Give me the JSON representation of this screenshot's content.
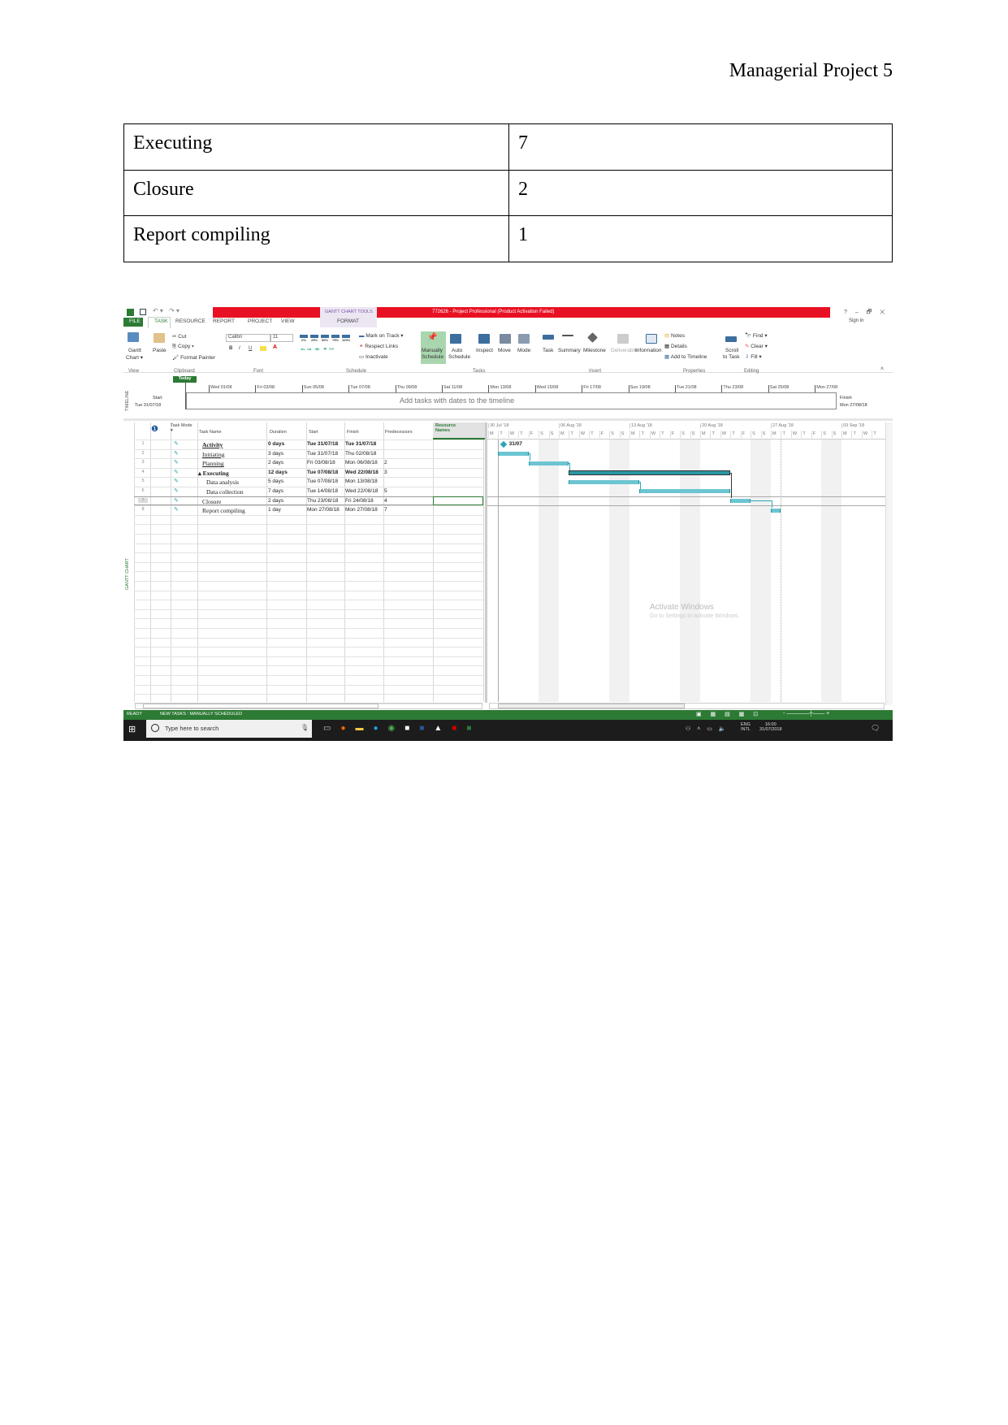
{
  "page_header": "Managerial Project 5",
  "phase_table": [
    [
      "Executing",
      "7"
    ],
    [
      "Closure",
      "2"
    ],
    [
      "Report compiling",
      "1"
    ]
  ],
  "app": {
    "title": "772626 - Project Professional (Product Activation Failed)",
    "context_tab": "GANTT CHART TOOLS",
    "window_controls": [
      "?",
      "–",
      "🗗",
      "✕"
    ],
    "sign_in": "Sign in",
    "tabs": [
      "FILE",
      "TASK",
      "RESOURCE",
      "REPORT",
      "PROJECT",
      "VIEW",
      "FORMAT"
    ],
    "active_tab": "TASK",
    "ribbon": {
      "view": {
        "gantt": "Gantt",
        "chart": "Chart ▾",
        "group": "View"
      },
      "clipboard": {
        "paste": "Paste",
        "cut": "Cut",
        "copy": "Copy ▾",
        "format_painter": "Format Painter",
        "group": "Clipboard"
      },
      "font": {
        "name": "Calibri",
        "size": "11",
        "bold": "B",
        "italic": "I",
        "underline": "U",
        "group": "Font"
      },
      "schedule": {
        "pcts": [
          "0%",
          "25%",
          "50%",
          "75%",
          "100%"
        ],
        "mark_on_track": "Mark on Track ▾",
        "respect_links": "Respect Links",
        "inactivate": "Inactivate",
        "group": "Schedule"
      },
      "tasks": {
        "manually": "Manually",
        "schedule1": "Schedule",
        "auto": "Auto",
        "schedule2": "Schedule",
        "inspect": "Inspect",
        "move": "Move",
        "mode": "Mode",
        "group": "Tasks"
      },
      "insert": {
        "task": "Task",
        "summary": "Summary",
        "milestone": "Milestone",
        "deliverable": "Deliverable",
        "group": "Insert"
      },
      "properties": {
        "information": "Information",
        "notes": "Notes",
        "details": "Details",
        "add_to_timeline": "Add to Timeline",
        "group": "Properties"
      },
      "editing": {
        "scroll": "Scroll",
        "to_task": "to Task",
        "find": "Find ▾",
        "clear": "Clear ▾",
        "fill": "Fill ▾",
        "group": "Editing"
      }
    },
    "timeline": {
      "side_label": "TIMELINE",
      "today": "Today",
      "start_label": "Start",
      "start_date": "Tue 31/07/18",
      "finish_label": "Finish",
      "finish_date": "Mon 27/08/18",
      "placeholder": "Add tasks with dates to the timeline",
      "ticks": [
        "Wed 01/08",
        "Fri 03/08",
        "Sun 05/08",
        "Tue 07/08",
        "Thu 09/08",
        "Sat 11/08",
        "Mon 13/08",
        "Wed 15/08",
        "Fri 17/08",
        "Sun 19/08",
        "Tue 21/08",
        "Thu 23/08",
        "Sat 25/08",
        "Mon 27/08"
      ]
    },
    "grid": {
      "side_label": "GANTT CHART",
      "columns": {
        "mode": "Task Mode ▾",
        "name": "Task Name",
        "duration": "Duration",
        "start": "Start",
        "finish": "Finish",
        "pred": "Predecessors",
        "res": "Resource Names"
      },
      "rows": [
        {
          "id": "1",
          "name": "Activity",
          "duration": "0 days",
          "start": "Tue 31/07/18",
          "finish": "Tue 31/07/18",
          "pred": "",
          "bold": true,
          "s": "2018-07-31",
          "f": "2018-07-31",
          "milestone": true
        },
        {
          "id": "2",
          "name": "Initiating",
          "duration": "3 days",
          "start": "Tue 31/07/18",
          "finish": "Thu 02/08/18",
          "pred": "",
          "s": "2018-07-31",
          "f": "2018-08-02"
        },
        {
          "id": "3",
          "name": "Planning",
          "duration": "2 days",
          "start": "Fri 03/08/18",
          "finish": "Mon 06/08/18",
          "pred": "2",
          "s": "2018-08-03",
          "f": "2018-08-06"
        },
        {
          "id": "4",
          "name": "▴ Executing",
          "duration": "12 days",
          "start": "Tue 07/08/18",
          "finish": "Wed 22/08/18",
          "pred": "3",
          "bold": true,
          "summary": true,
          "s": "2018-08-07",
          "f": "2018-08-22"
        },
        {
          "id": "5",
          "name": "Data analysis",
          "duration": "5 days",
          "start": "Tue 07/08/18",
          "finish": "Mon 13/08/18",
          "pred": "",
          "indent": true,
          "s": "2018-08-07",
          "f": "2018-08-13"
        },
        {
          "id": "6",
          "name": "Data collection",
          "duration": "7 days",
          "start": "Tue 14/08/18",
          "finish": "Wed 22/08/18",
          "pred": "5",
          "indent": true,
          "s": "2018-08-14",
          "f": "2018-08-22"
        },
        {
          "id": "7",
          "name": "Closure",
          "duration": "2 days",
          "start": "Thu 23/08/18",
          "finish": "Fri 24/08/18",
          "pred": "4",
          "s": "2018-08-23",
          "f": "2018-08-24",
          "selected": true
        },
        {
          "id": "8",
          "name": "Report compiling",
          "duration": "1 day",
          "start": "Mon 27/08/18",
          "finish": "Mon 27/08/18",
          "pred": "7",
          "s": "2018-08-27",
          "f": "2018-08-27"
        }
      ]
    },
    "gantt": {
      "weeks": [
        "30 Jul '18",
        "06 Aug '18",
        "13 Aug '18",
        "20 Aug '18",
        "27 Aug '18",
        "03 Sep '18"
      ],
      "day_letters": [
        "M",
        "T",
        "W",
        "T",
        "F",
        "S",
        "S"
      ],
      "milestone_label": "31/07",
      "bar_color": "#6cc5d1"
    },
    "watermark": {
      "line1": "Activate Windows",
      "line2": "Go to Settings to activate Windows."
    },
    "status": {
      "ready": "READY",
      "new_tasks": "NEW TASKS : MANUALLY SCHEDULED",
      "accent": "#2c7a34"
    },
    "taskbar": {
      "search": "Type here to search",
      "lang1": "ENG",
      "lang2": "INTL",
      "time": "16:00",
      "date": "31/07/2018"
    }
  }
}
